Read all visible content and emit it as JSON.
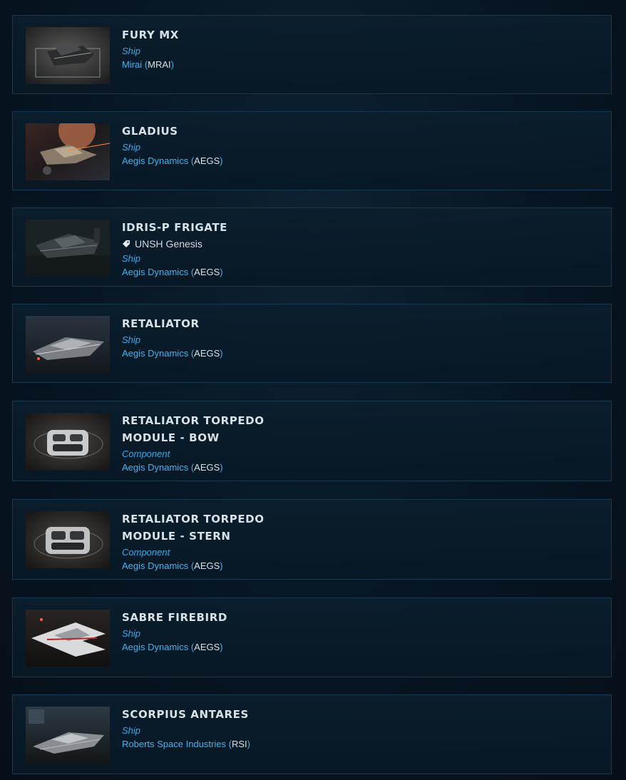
{
  "items": [
    {
      "title": "FURY MX",
      "tag": "",
      "type": "Ship",
      "manufacturer": "Mirai",
      "code": "MRAI",
      "thumb_icon": "fury-mx-thumbnail"
    },
    {
      "title": "GLADIUS",
      "tag": "",
      "type": "Ship",
      "manufacturer": "Aegis Dynamics",
      "code": "AEGS",
      "thumb_icon": "gladius-thumbnail"
    },
    {
      "title": "IDRIS-P FRIGATE",
      "tag": "UNSH Genesis",
      "type": "Ship",
      "manufacturer": "Aegis Dynamics",
      "code": "AEGS",
      "thumb_icon": "idris-thumbnail"
    },
    {
      "title": "RETALIATOR",
      "tag": "",
      "type": "Ship",
      "manufacturer": "Aegis Dynamics",
      "code": "AEGS",
      "thumb_icon": "retaliator-thumbnail"
    },
    {
      "title": "RETALIATOR TORPEDO MODULE - BOW",
      "tag": "",
      "type": "Component",
      "manufacturer": "Aegis Dynamics",
      "code": "AEGS",
      "thumb_icon": "torpedo-bow-thumbnail"
    },
    {
      "title": "RETALIATOR TORPEDO MODULE - STERN",
      "tag": "",
      "type": "Component",
      "manufacturer": "Aegis Dynamics",
      "code": "AEGS",
      "thumb_icon": "torpedo-stern-thumbnail"
    },
    {
      "title": "SABRE FIREBIRD",
      "tag": "",
      "type": "Ship",
      "manufacturer": "Aegis Dynamics",
      "code": "AEGS",
      "thumb_icon": "sabre-firebird-thumbnail"
    },
    {
      "title": "SCORPIUS ANTARES",
      "tag": "",
      "type": "Ship",
      "manufacturer": "Roberts Space Industries",
      "code": "RSI",
      "thumb_icon": "scorpius-thumbnail"
    }
  ],
  "icons": {
    "tag": "tag-icon"
  },
  "colors": {
    "accent": "#44b2f0",
    "title": "#d8e1e6",
    "border": "#163a52",
    "background": "#071522"
  }
}
